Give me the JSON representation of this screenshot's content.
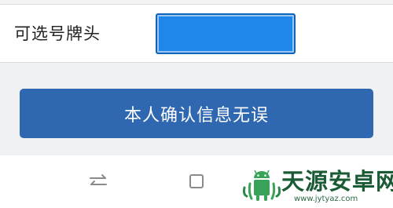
{
  "form": {
    "plate_prefix_label": "可选号牌头",
    "plate_prefix_value": ""
  },
  "actions": {
    "confirm_label": "本人确认信息无误"
  },
  "system_nav": {
    "icons": [
      "switch-apps-icon",
      "home-square-icon"
    ]
  },
  "watermark": {
    "title": "天源安卓网",
    "url": "www.jytyaz.com"
  },
  "colors": {
    "accent_blue": "#1f86ea",
    "button_blue": "#2f67b0",
    "page_gray": "#eff1f3",
    "watermark_green": "#1a5a34"
  }
}
